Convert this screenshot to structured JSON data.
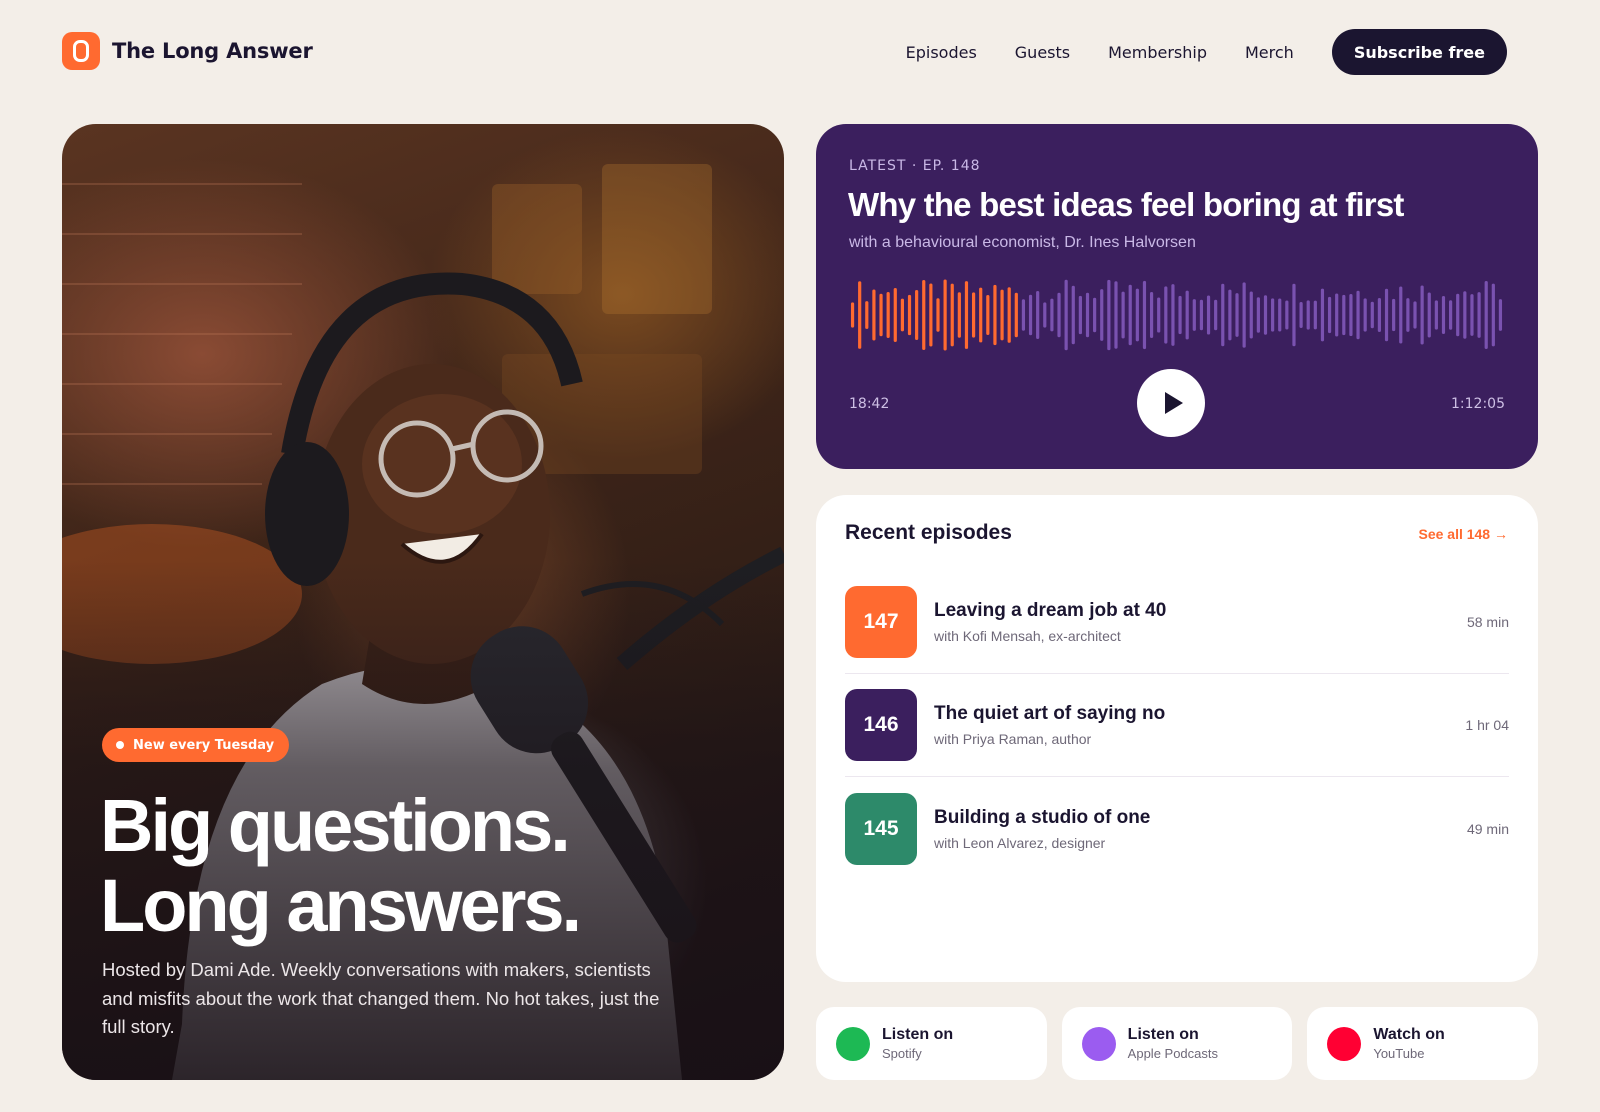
{
  "brand": {
    "name": "The Long Answer",
    "accent": "#ff6a30"
  },
  "nav": {
    "links": [
      "Episodes",
      "Guests",
      "Membership",
      "Merch"
    ],
    "cta": "Subscribe free"
  },
  "hero": {
    "badge": "New every Tuesday",
    "title_line1": "Big questions.",
    "title_line2": "Long answers.",
    "description": "Hosted by Dami Ade. Weekly conversations with makers, scientists and misfits about the work that changed them. No hot takes, just the full story."
  },
  "player": {
    "kicker": "LATEST · EP. 148",
    "title": "Why the best ideas feel boring at first",
    "subtitle": "with a behavioural economist, Dr. Ines Halvorsen",
    "elapsed": "18:42",
    "total": "1:12:05",
    "progress": 0.26,
    "background": "#3b1f5e",
    "played_color": "#ff6a30",
    "unplayed_color": "#7a52b0"
  },
  "recent": {
    "title": "Recent episodes",
    "see_all": "See all 148 →",
    "episodes": [
      {
        "number": "147",
        "title": "Leaving a dream job at 40",
        "guest": "with Kofi Mensah, ex-architect",
        "duration": "58 min",
        "color": "#ff6a30"
      },
      {
        "number": "146",
        "title": "The quiet art of saying no",
        "guest": "with Priya Raman, author",
        "duration": "1 hr 04",
        "color": "#3b1f5e"
      },
      {
        "number": "145",
        "title": "Building a studio of one",
        "guest": "with Leon Alvarez, designer",
        "duration": "49 min",
        "color": "#2d8a6a"
      }
    ]
  },
  "platforms": [
    {
      "action": "Listen on",
      "name": "Spotify",
      "color": "#1db954"
    },
    {
      "action": "Listen on",
      "name": "Apple Podcasts",
      "color": "#9b5cf0"
    },
    {
      "action": "Watch on",
      "name": "YouTube",
      "color": "#ff0033"
    }
  ]
}
